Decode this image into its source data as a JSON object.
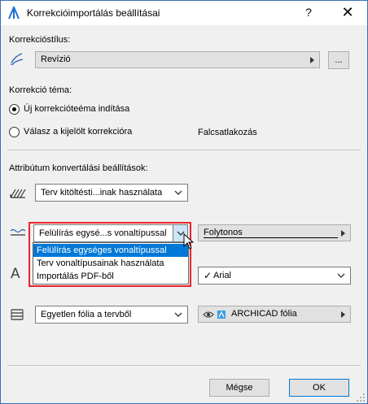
{
  "window": {
    "title": "Korrekcióimportálás beállításai",
    "help": "?",
    "close": "✕"
  },
  "style_section": {
    "label": "Korrekcióstílus:",
    "combo_value": "Revízió",
    "more_button": "..."
  },
  "topic_section": {
    "label": "Korrekció téma:",
    "option_new": "Új korrekcióteéma indítása",
    "option_reply": "Válasz a kijelölt korrekcióra",
    "reply_target": "Falcsatlakozás"
  },
  "attr_section": {
    "label": "Attribútum konvertálási beállítások:",
    "fill_select": "Terv kitöltésti...inak használata",
    "line_select": "Felülírás egysé...s vonaltípussal",
    "line_style": "Folytonos",
    "font_value": "Arial",
    "layer_select": "Egyetlen fólia a tervből",
    "layer_value": "ARCHICAD fólia"
  },
  "dropdown": {
    "options": [
      "Felülírás egységes vonaltípussal",
      "Terv vonaltípusainak használata",
      "Importálás PDF-ből"
    ],
    "selected_index": 0
  },
  "footer": {
    "cancel": "Mégse",
    "ok": "OK"
  },
  "colors": {
    "accent": "#0078d7",
    "highlight_frame": "#e8232e"
  }
}
